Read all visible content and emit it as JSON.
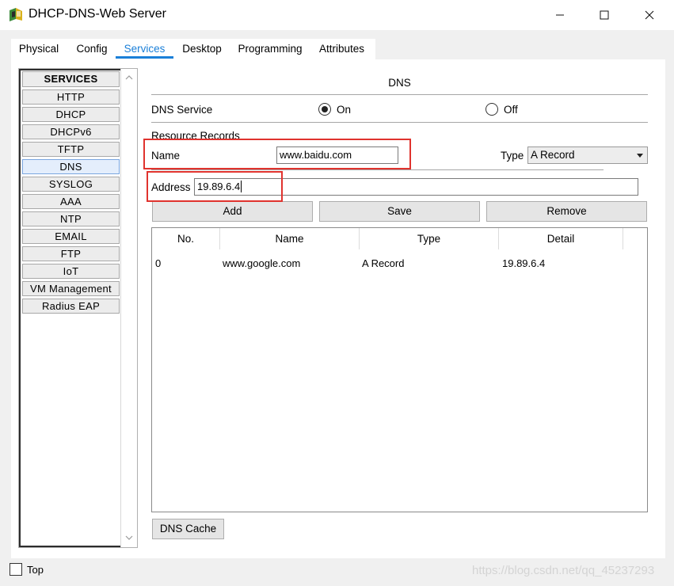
{
  "window": {
    "title": "DHCP-DNS-Web Server"
  },
  "tabs": [
    {
      "label": "Physical"
    },
    {
      "label": "Config"
    },
    {
      "label": "Services"
    },
    {
      "label": "Desktop"
    },
    {
      "label": "Programming"
    },
    {
      "label": "Attributes"
    }
  ],
  "active_tab": "Services",
  "sidebar": {
    "items": [
      {
        "label": "SERVICES"
      },
      {
        "label": "HTTP"
      },
      {
        "label": "DHCP"
      },
      {
        "label": "DHCPv6"
      },
      {
        "label": "TFTP"
      },
      {
        "label": "DNS"
      },
      {
        "label": "SYSLOG"
      },
      {
        "label": "AAA"
      },
      {
        "label": "NTP"
      },
      {
        "label": "EMAIL"
      },
      {
        "label": "FTP"
      },
      {
        "label": "IoT"
      },
      {
        "label": "VM Management"
      },
      {
        "label": "Radius EAP"
      }
    ],
    "selected": "DNS"
  },
  "dns": {
    "heading": "DNS",
    "service_label": "DNS Service",
    "on_label": "On",
    "off_label": "Off",
    "service_state": "On",
    "resource_records_label": "Resource Records",
    "name_label": "Name",
    "name_value": "www.baidu.com",
    "type_label": "Type",
    "type_value": "A Record",
    "address_label": "Address",
    "address_value": "19.89.6.4",
    "add_label": "Add",
    "save_label": "Save",
    "remove_label": "Remove",
    "table": {
      "columns": [
        "No.",
        "Name",
        "Type",
        "Detail"
      ],
      "rows": [
        {
          "no": "0",
          "name": "www.google.com",
          "type": "A Record",
          "detail": "19.89.6.4"
        }
      ]
    },
    "cache_label": "DNS Cache"
  },
  "footer": {
    "top_label": "Top",
    "watermark": "https://blog.csdn.net/qq_45237293"
  },
  "colors": {
    "accent": "#1a7fd8",
    "highlight_box": "#e0332e"
  }
}
